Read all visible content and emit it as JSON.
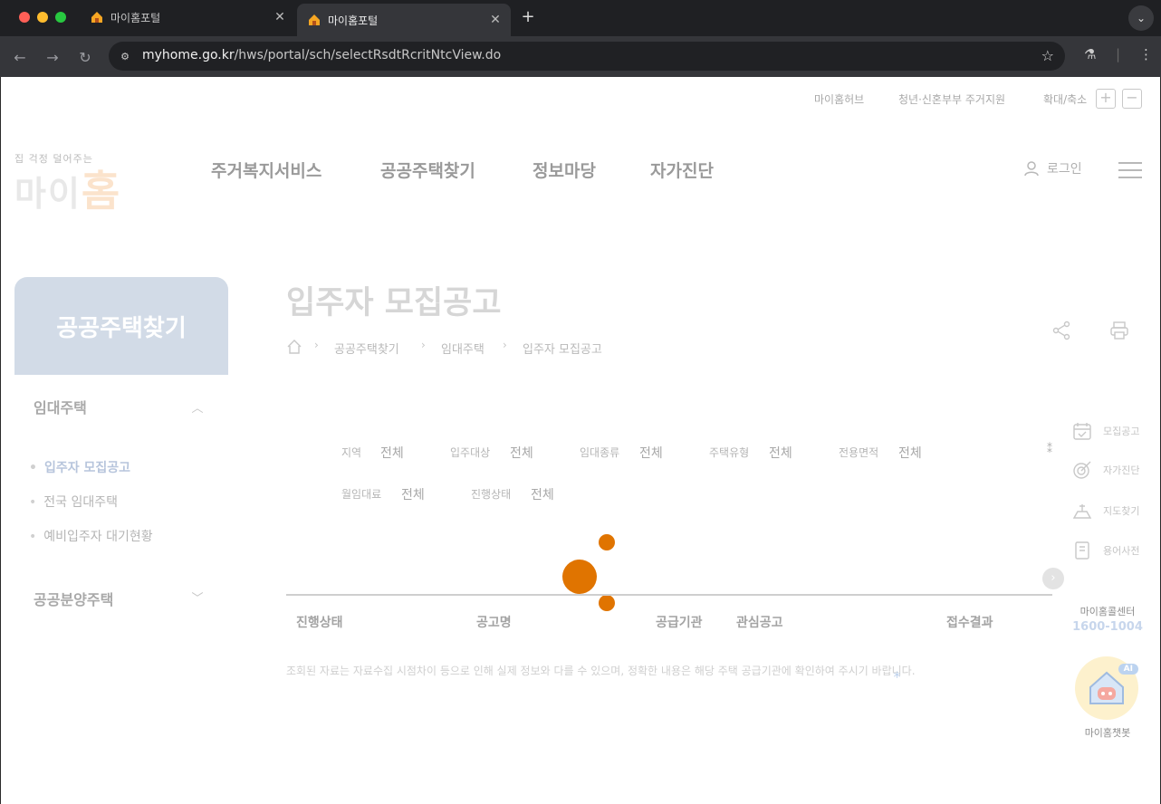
{
  "browser": {
    "tabs": [
      {
        "title": "마이홈포털",
        "active": false
      },
      {
        "title": "마이홈포털",
        "active": true
      }
    ],
    "new_tab_symbol": "+",
    "tab_close_symbol": "✕",
    "url_domain": "myhome.go.kr",
    "url_path": "/hws/portal/sch/selectRsdtRcritNtcView.do",
    "colors": {
      "close": "#fe5f57",
      "minimize": "#febc2e",
      "maximize": "#28c840"
    }
  },
  "util": {
    "myhome_hub": "마이홈허브",
    "youth_support": "청년·신혼부부 주거지원",
    "zoom_label": "확대/축소",
    "zoom_in": "+",
    "zoom_out": "−"
  },
  "logo": {
    "tagline": "집 걱정 덜어주는",
    "name_part1": "마이",
    "name_part2": "홈"
  },
  "gnb": [
    "주거복지서비스",
    "공공주택찾기",
    "정보마당",
    "자가진단"
  ],
  "header": {
    "login": "로그인"
  },
  "lnb": {
    "title": "공공주택찾기",
    "group1": "임대주택",
    "items": [
      "입주자 모집공고",
      "전국 임대주택",
      "예비입주자 대기현황"
    ],
    "group2": "공공분양주택"
  },
  "main": {
    "title": "입주자 모집공고",
    "breadcrumb": [
      "공공주택찾기",
      "임대주택",
      "입주자 모집공고"
    ],
    "filters": [
      {
        "label": "지역",
        "value": "전체"
      },
      {
        "label": "입주대상",
        "value": "전체"
      },
      {
        "label": "임대종류",
        "value": "전체"
      },
      {
        "label": "주택유형",
        "value": "전체"
      },
      {
        "label": "전용면적",
        "value": "전체"
      },
      {
        "label": "월임대료",
        "value": "전체"
      },
      {
        "label": "진행상태",
        "value": "전체"
      }
    ],
    "table_headers": [
      "진행상태",
      "공고명",
      "공급기관",
      "관심공고",
      "접수결과"
    ],
    "notice": "조회된 자료는 자료수집 시점차이 등으로 인해 실제 정보와 다를 수 있으며, 정확한 내용은 해당 주택 공급기관에 확인하여 주시기 바랍니다.",
    "notice_mark": "*",
    "loader_color": "#e07400"
  },
  "quick_menu": {
    "items": [
      "모집공고",
      "자가진단",
      "지도찾기",
      "용어사전"
    ],
    "center_label": "마이홈콜센터",
    "center_phone": "1600-1004",
    "chatbot_badge": "AI",
    "chatbot_label": "마이홈챗봇"
  }
}
